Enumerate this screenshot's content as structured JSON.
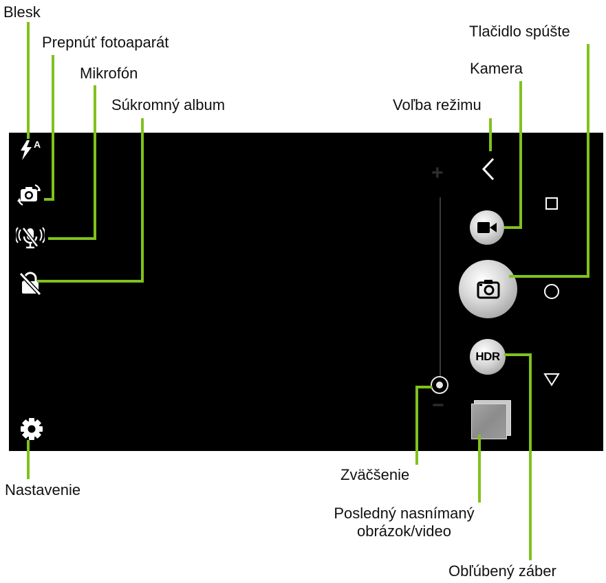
{
  "labels": {
    "flash": "Blesk",
    "switch_camera": "Prepnúť fotoaparát",
    "microphone": "Mikrofón",
    "private_album": "Súkromný album",
    "mode_select": "Voľba režimu",
    "camera": "Kamera",
    "shutter": "Tlačidlo spúšte",
    "zoom": "Zväčšenie",
    "last_capture_line1": "Posledný nasnímaný",
    "last_capture_line2": "obrázok/video",
    "favorite_shot": "Obľúbený záber",
    "settings": "Nastavenie"
  },
  "screen": {
    "flash_mode_indicator": "A",
    "hdr_label": "HDR",
    "zoom_plus": "+",
    "zoom_minus": "−",
    "zoom_level": 0,
    "icons": {
      "flash": "flash-auto-icon",
      "switch_camera": "switch-camera-icon",
      "microphone": "microphone-muted-icon",
      "private_album": "lock-off-icon",
      "settings": "gear-icon",
      "mode_select": "chevron-left-icon",
      "camera": "video-camera-icon",
      "shutter": "photo-camera-icon",
      "nav_recent": "square-icon",
      "nav_home": "circle-icon",
      "nav_back": "triangle-down-icon"
    }
  },
  "colors": {
    "callout_line": "#80c21c",
    "screen_bg": "#000000",
    "icon": "#ffffff"
  }
}
